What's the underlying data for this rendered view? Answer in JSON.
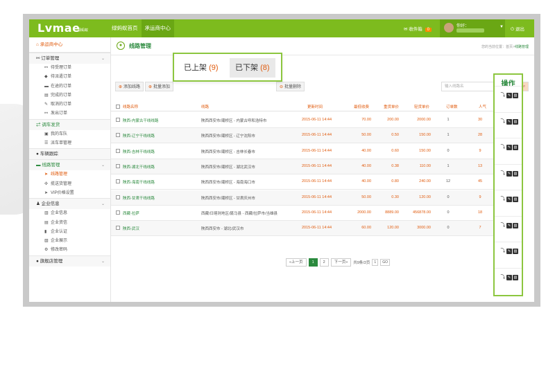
{
  "header": {
    "logo": "Lvmae",
    "logo_sub": "绿蚂蚁",
    "nav": [
      "绿蚂蚁首页",
      "承运商中心"
    ],
    "inbox_label": "收件箱",
    "inbox_count": "0",
    "hello": "你好：",
    "logout": "退出"
  },
  "sidebar": {
    "head": "承运商中心",
    "groups": [
      {
        "label": "订单管理",
        "items": [
          "待受理订单",
          "待派遣订单",
          "在途的订单",
          "完成的订单",
          "取消的订单",
          "发出订单"
        ]
      },
      {
        "label": "调车发货",
        "items": [
          "我的车队",
          "派车单管理"
        ]
      },
      {
        "label": "车辆跟踪",
        "items": []
      },
      {
        "label": "线路管理",
        "items": [
          "线路管理",
          "揽送货管理",
          "VIP价格设置"
        ]
      },
      {
        "label": "企业信息",
        "items": [
          "企业信息",
          "企业资信",
          "企业认证",
          "企业展示",
          "修改密码"
        ]
      },
      {
        "label": "旗舰店管理",
        "items": []
      }
    ]
  },
  "main": {
    "title": "线路管理",
    "crumb_prefix": "您的当前位置：首页",
    "crumb_current": "线路管理",
    "toolbar": {
      "add": "添加线路",
      "batch_add": "批量添加",
      "batch_delete": "批量删除",
      "search_placeholder": "输入线路名"
    },
    "tabs": [
      {
        "label": "已上架",
        "count": "(9)"
      },
      {
        "label": "已下架",
        "count": "(8)"
      }
    ],
    "ops_title": "操作",
    "columns": [
      "线路名称",
      "线路",
      "更新时间",
      "最低收费",
      "重货单价",
      "轻货单价",
      "订单数",
      "人气"
    ],
    "rows": [
      [
        "陕西-内蒙古干线线路",
        "陕西西安市/灞桥区 - 内蒙古呼和浩特市",
        "2015-06-11 14:44",
        "70.00",
        "200.00",
        "2000.00",
        "1",
        "30"
      ],
      [
        "陕西-辽宁干线线路",
        "陕西西安市/灞桥区 - 辽宁沈阳市",
        "2015-06-11 14:44",
        "50.00",
        "0.50",
        "150.00",
        "1",
        "28"
      ],
      [
        "陕西-吉林干线线路",
        "陕西西安市/灞桥区 - 吉林长春市",
        "2015-06-11 14:44",
        "40.00",
        "0.60",
        "150.00",
        "0",
        "9"
      ],
      [
        "陕西-湖北干线线路",
        "陕西西安市/灞桥区 - 湖北武汉市",
        "2015-06-11 14:44",
        "40.00",
        "0.38",
        "110.00",
        "1",
        "13"
      ],
      [
        "陕西-海南干线线路",
        "陕西西安市/灞桥区 - 海南海口市",
        "2015-06-11 14:44",
        "40.00",
        "0.80",
        "240.00",
        "12",
        "45"
      ],
      [
        "陕西-甘肃干线线路",
        "陕西西安市/灞桥区 - 甘肃庆州市",
        "2015-06-11 14:44",
        "50.00",
        "0.30",
        "120.00",
        "0",
        "9"
      ],
      [
        "西藏-拉萨",
        "西藏/日喀则地区/聂马县 - 西藏/拉萨市/当雄县",
        "2015-06-11 14:44",
        "2000.00",
        "8889.00",
        "456878.00",
        "0",
        "18"
      ],
      [
        "陕西-武汉",
        "陕西西安市 - 湖北/武汉市",
        "2015-06-11 14:44",
        "60.00",
        "120.00",
        "3000.00",
        "0",
        "7"
      ]
    ],
    "pager": {
      "prev": "«上一页",
      "pages": [
        "1",
        "2"
      ],
      "next": "下一页»",
      "total": "共9条/2页",
      "jump_value": "1",
      "go": "GO"
    }
  },
  "colors": {
    "brand_green": "#7dbb1e",
    "link_green": "#2b8a3e",
    "accent_orange": "#e05a0c"
  }
}
